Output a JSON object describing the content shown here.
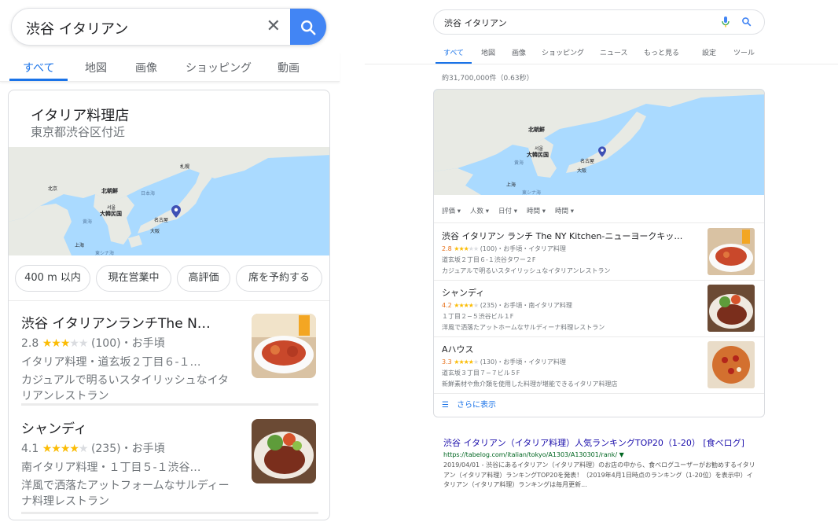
{
  "mobile": {
    "search": {
      "query": "渋谷 イタリアン"
    },
    "tabs": [
      "すべて",
      "地図",
      "画像",
      "ショッピング",
      "動画"
    ],
    "local": {
      "title": "イタリア料理店",
      "subtitle": "東京都渋谷区付近",
      "map_labels": {
        "north_korea": "北朝鮮",
        "south_korea": "大韓民国",
        "sea_of_japan": "日本海",
        "seoul": "서울",
        "nagoya": "名古屋",
        "osaka": "大阪",
        "sapporo": "札幌",
        "beijing": "北京",
        "shanghai": "上海",
        "yellow_sea": "黄海",
        "east_china_sea": "東シナ海"
      },
      "chips": [
        "400 m 以内",
        "現在営業中",
        "高評価",
        "席を予約する"
      ],
      "items": [
        {
          "name": "渋谷 イタリアンランチThe N…",
          "rating": "2.8",
          "stars": 3,
          "reviews": "(100)",
          "price": "・お手頃",
          "meta": "イタリア料理・道玄坂２丁目６-１…",
          "desc": "カジュアルで明るいスタイリッシュなイタリアンレストラン"
        },
        {
          "name": "シャンディ",
          "rating": "4.1",
          "stars": 4,
          "reviews": "(235)",
          "price": "・お手頃",
          "meta": "南イタリア料理・１丁目５-１渋谷…",
          "desc": "洋風で洒落たアットフォームなサルディーナ料理レストラン"
        }
      ]
    }
  },
  "desktop": {
    "search": {
      "query": "渋谷 イタリアン"
    },
    "tabs": [
      "すべて",
      "地図",
      "画像",
      "ショッピング",
      "ニュース",
      "もっと見る",
      "設定",
      "ツール"
    ],
    "result_count": "約31,700,000件（0.63秒）",
    "local": {
      "map_labels": {
        "north_korea": "北朝鮮",
        "south_korea": "大韓民国",
        "seoul": "서울",
        "nagoya": "名古屋",
        "osaka": "大阪",
        "yellow_sea": "黄海",
        "shanghai": "上海",
        "east_china_sea": "東シナ海"
      },
      "filters": [
        "評価",
        "人数",
        "日付",
        "時間",
        "時間"
      ],
      "items": [
        {
          "name": "渋谷 イタリアン ランチ The NY Kitchen-ニューヨークキッ…",
          "rating": "2.8",
          "stars": 3,
          "meta": "(100)・お手頃・イタリア料理",
          "address": "道玄坂２丁目６-１渋谷タワー２F",
          "desc": "カジュアルで明るいスタイリッシュなイタリアンレストラン"
        },
        {
          "name": "シャンディ",
          "rating": "4.2",
          "stars": 4,
          "meta": "(235)・お手頃・南イタリア料理",
          "address": "１丁目２−５渋谷ビル１F",
          "desc": "洋風で洒落たアットホームなサルディーナ料理レストラン"
        },
        {
          "name": "Aハウス",
          "rating": "3.3",
          "stars": 4,
          "meta": "(130)・お手頃・イタリア料理",
          "address": "道玄坂３丁目７−７ビル５F",
          "desc": "新鮮素材や魚介類を使用した料理が堪能できるイタリア料理店"
        }
      ],
      "more": "さらに表示"
    },
    "result": {
      "title": "渋谷 イタリアン（イタリア料理）人気ランキングTOP20（1-20） [食べログ]",
      "url": "https://tabelog.com/italian/tokyo/A1303/A130301/rank/ ▼",
      "snippet": "2019/04/01 - 渋谷にあるイタリアン（イタリア料理）のお店の中から、食べログユーザーがお勧めするイタリアン（イタリア料理）ランキングTOP20を発表！（2019年4月1日時点のランキング（1-20位）を表示中）イタリアン（イタリア料理）ランキングは毎月更新..."
    }
  },
  "colors": {
    "accent": "#1a73e8",
    "star": "#fbbc04",
    "link": "#1a0dab",
    "url": "#006621"
  }
}
